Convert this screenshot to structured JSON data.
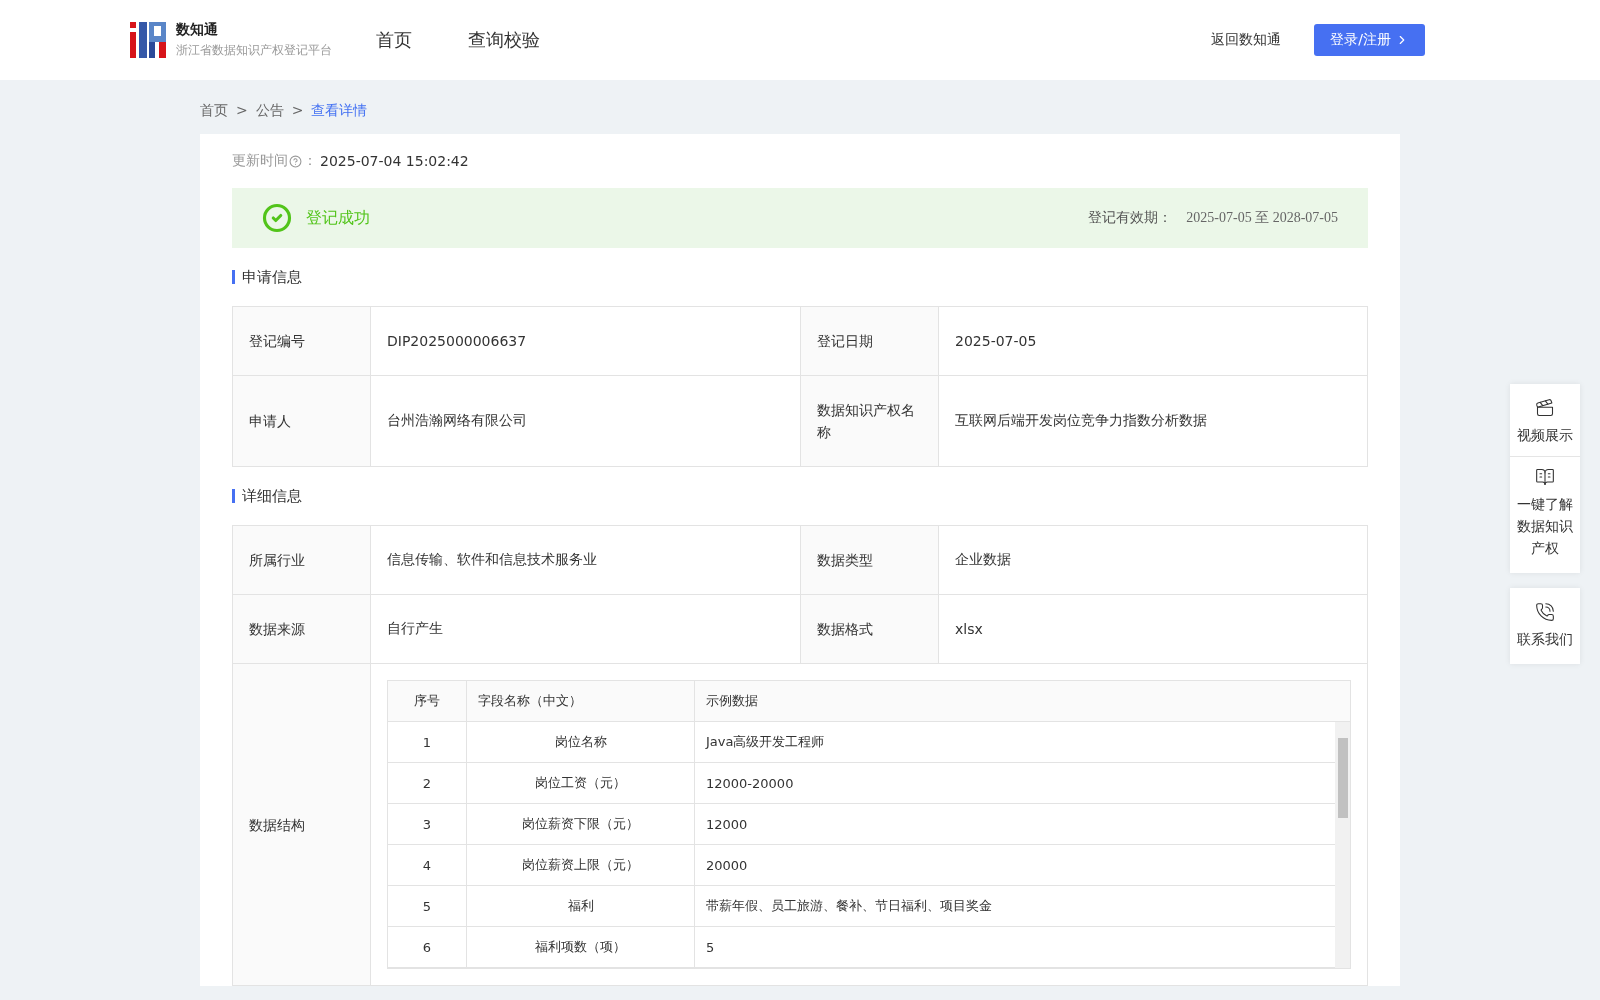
{
  "header": {
    "logo": {
      "title": "数知通",
      "subtitle": "浙江省数据知识产权登记平台"
    },
    "nav": [
      {
        "label": "首页",
        "selected": false
      },
      {
        "label": "查询校验",
        "selected": false
      }
    ],
    "back_link": "返回数知通",
    "login_button": "登录/注册"
  },
  "breadcrumb": {
    "separator": ">",
    "items": [
      "首页",
      "公告",
      "查看详情"
    ]
  },
  "update": {
    "label": "更新时间",
    "colon": "：",
    "value": "2025-07-04 15:02:42"
  },
  "status": {
    "kind": "success",
    "text": "登记成功",
    "validity_label": "登记有效期：",
    "validity": "2025-07-05 至 2028-07-05"
  },
  "sections": [
    {
      "title": "申请信息",
      "rows": [
        [
          {
            "label": "登记编号",
            "value": "DIP2025000006637"
          },
          {
            "label": "登记日期",
            "value": "2025-07-05"
          }
        ],
        [
          {
            "label": "申请人",
            "value": "台州浩瀚网络有限公司"
          },
          {
            "label": "数据知识产权名称",
            "value": "互联网后端开发岗位竞争力指数分析数据"
          }
        ]
      ]
    },
    {
      "title": "详细信息",
      "rows": [
        [
          {
            "label": "所属行业",
            "value": "信息传输、软件和信息技术服务业"
          },
          {
            "label": "数据类型",
            "value": "企业数据"
          }
        ],
        [
          {
            "label": "数据来源",
            "value": "自行产生"
          },
          {
            "label": "数据格式",
            "value": "xlsx"
          }
        ]
      ],
      "structure": {
        "label": "数据结构",
        "columns": [
          "序号",
          "字段名称（中文）",
          "示例数据"
        ],
        "rows": [
          [
            "1",
            "岗位名称",
            "Java高级开发工程师"
          ],
          [
            "2",
            "岗位工资（元）",
            "12000-20000"
          ],
          [
            "3",
            "岗位薪资下限（元）",
            "12000"
          ],
          [
            "4",
            "岗位薪资上限（元）",
            "20000"
          ],
          [
            "5",
            "福利",
            "带薪年假、员工旅游、餐补、节日福利、项目奖金"
          ],
          [
            "6",
            "福利项数（项）",
            "5"
          ]
        ]
      }
    }
  ],
  "side_panel": [
    {
      "kind": "video",
      "label": "视频展示"
    },
    {
      "kind": "guide",
      "label": "一键了解数据知识产权"
    },
    {
      "kind": "contact",
      "label": "联系我们"
    }
  ]
}
